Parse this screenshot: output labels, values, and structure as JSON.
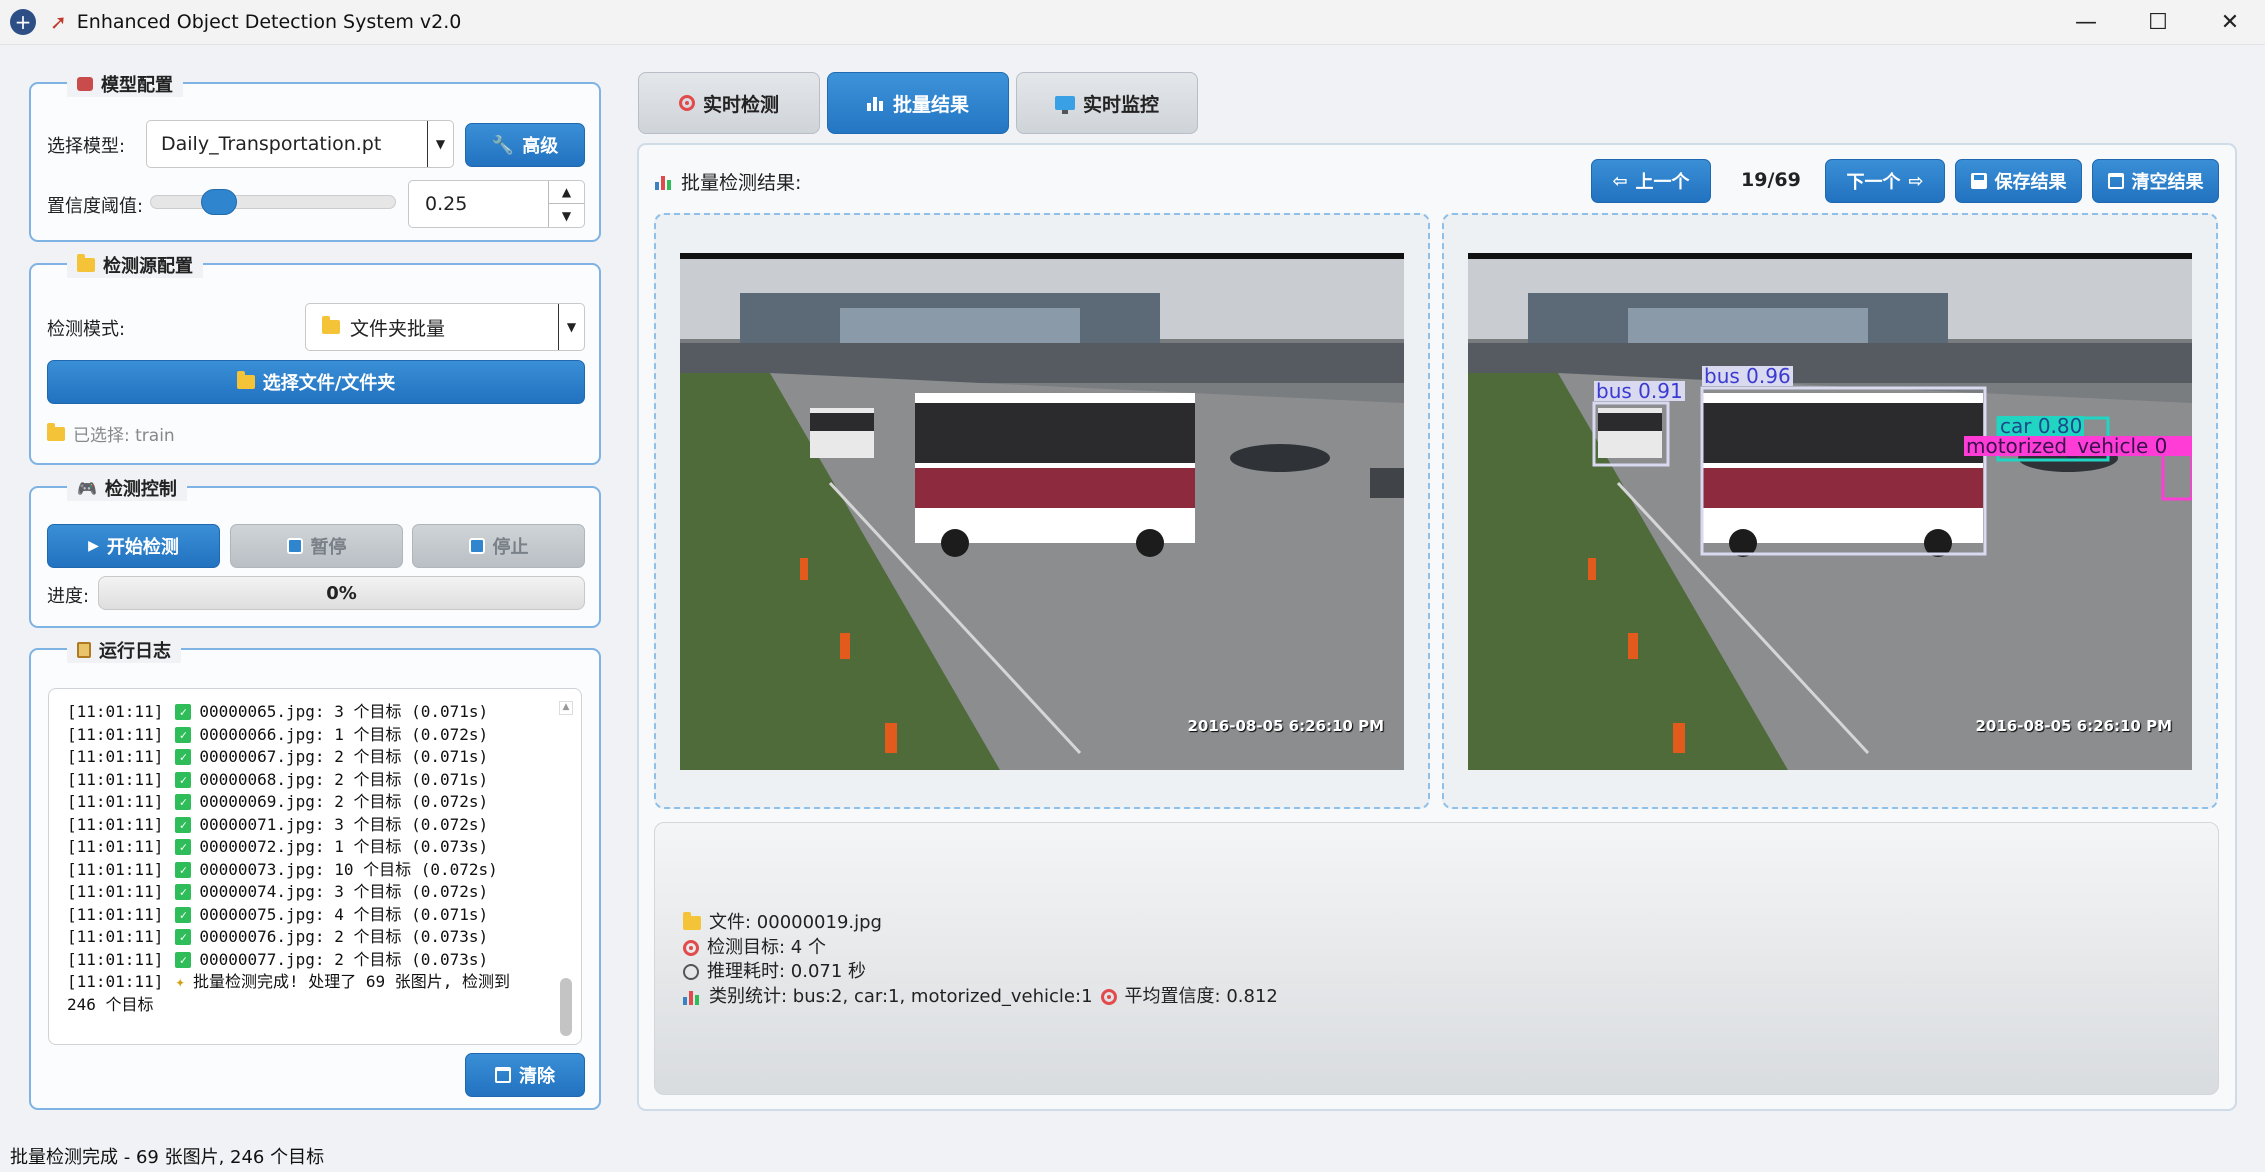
{
  "window": {
    "title": "Enhanced Object Detection System v2.0",
    "minimize": "—",
    "maximize": "☐",
    "close": "✕"
  },
  "model_config": {
    "title": "模型配置",
    "model_label": "选择模型:",
    "model_value": "Daily_Transportation.pt",
    "advanced_button": "高级",
    "confidence_label": "置信度阈值:",
    "confidence_value": "0.25",
    "confidence_slider_fraction": 0.25
  },
  "source_config": {
    "title": "检测源配置",
    "mode_label": "检测模式:",
    "mode_value": "文件夹批量",
    "select_button": "选择文件/文件夹",
    "selected_text": "已选择: train"
  },
  "control": {
    "title": "检测控制",
    "start_button": "开始检测",
    "pause_button": "暂停",
    "stop_button": "停止",
    "progress_label": "进度:",
    "progress_value": "0%"
  },
  "log": {
    "title": "运行日志",
    "lines": [
      {
        "time": "[11:01:11]",
        "text": "00000065.jpg: 3 个目标 (0.071s)"
      },
      {
        "time": "[11:01:11]",
        "text": "00000066.jpg: 1 个目标 (0.072s)"
      },
      {
        "time": "[11:01:11]",
        "text": "00000067.jpg: 2 个目标 (0.071s)"
      },
      {
        "time": "[11:01:11]",
        "text": "00000068.jpg: 2 个目标 (0.071s)"
      },
      {
        "time": "[11:01:11]",
        "text": "00000069.jpg: 2 个目标 (0.072s)"
      },
      {
        "time": "[11:01:11]",
        "text": "00000071.jpg: 3 个目标 (0.072s)"
      },
      {
        "time": "[11:01:11]",
        "text": "00000072.jpg: 1 个目标 (0.073s)"
      },
      {
        "time": "[11:01:11]",
        "text": "00000073.jpg: 10 个目标 (0.072s)"
      },
      {
        "time": "[11:01:11]",
        "text": "00000074.jpg: 3 个目标 (0.072s)"
      },
      {
        "time": "[11:01:11]",
        "text": "00000075.jpg: 4 个目标 (0.071s)"
      },
      {
        "time": "[11:01:11]",
        "text": "00000076.jpg: 2 个目标 (0.073s)"
      },
      {
        "time": "[11:01:11]",
        "text": "00000077.jpg: 2 个目标 (0.073s)"
      }
    ],
    "final_time": "[11:01:11]",
    "final_text": "批量检测完成! 处理了 69 张图片, 检测到",
    "final_text_cont": "246 个目标",
    "clear_button": "清除"
  },
  "tabs": [
    {
      "label": "实时检测",
      "icon": "target-icon"
    },
    {
      "label": "批量结果",
      "icon": "chart-icon"
    },
    {
      "label": "实时监控",
      "icon": "monitor-icon"
    }
  ],
  "results": {
    "label": "批量检测结果:",
    "prev_button": "上一个",
    "counter": "19/69",
    "next_button": "下一个",
    "save_button": "保存结果",
    "clear_button": "清空结果",
    "timestamp": "2016-08-05 6:26:10 PM",
    "detections": [
      {
        "label": "bus 0.91",
        "color": "#d9d9f0"
      },
      {
        "label": "bus 0.96",
        "color": "#d9d9f0"
      },
      {
        "label": "car 0.80",
        "color": "#20d6c2"
      },
      {
        "label": "motorized_vehicle 0",
        "color": "#ff3dd6"
      }
    ]
  },
  "info": {
    "file": "文件: 00000019.jpg",
    "targets": "检测目标: 4 个",
    "time": "推理耗时: 0.071 秒",
    "stats": "类别统计: bus:2, car:1, motorized_vehicle:1",
    "avg_conf": "平均置信度: 0.812"
  },
  "status_bar": "批量检测完成 - 69 张图片, 246 个目标"
}
